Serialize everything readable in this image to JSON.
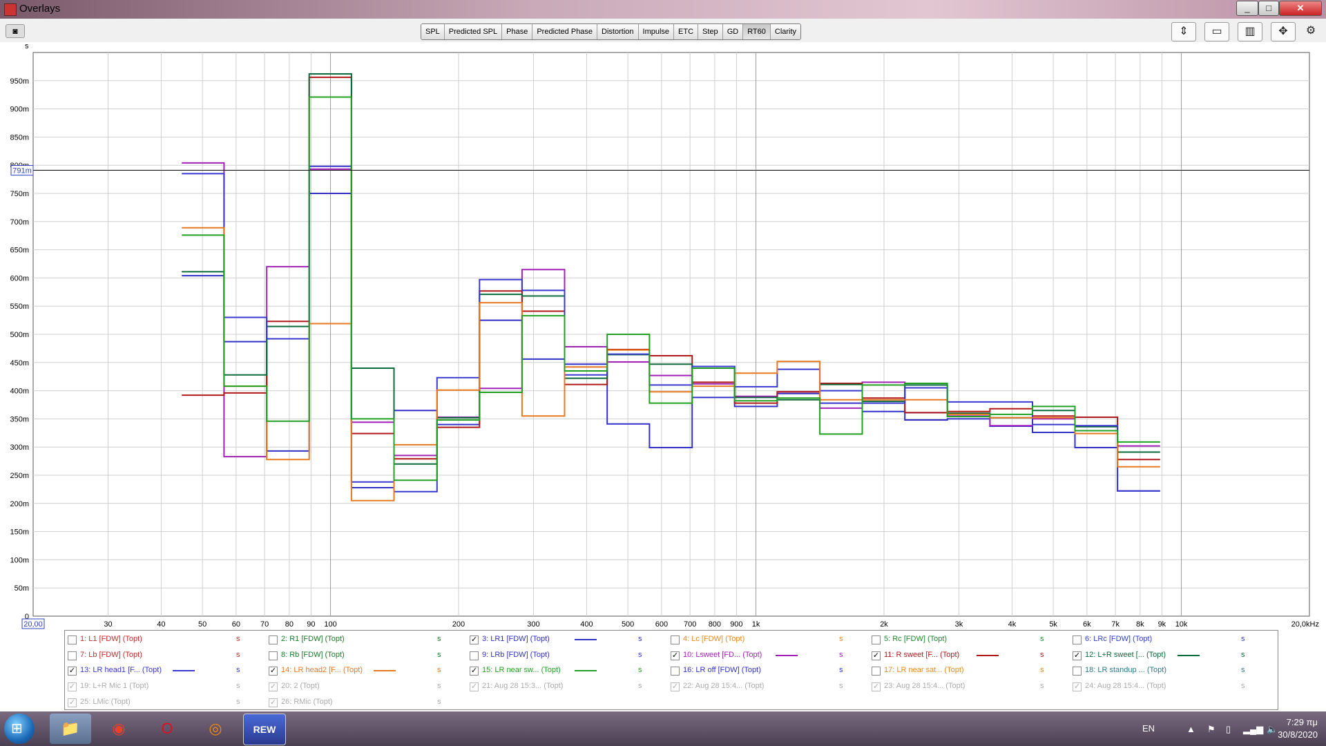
{
  "window": {
    "title": "Overlays",
    "min": "_",
    "max": "□",
    "close": "✕"
  },
  "tabs": [
    {
      "label": "SPL",
      "active": false
    },
    {
      "label": "Predicted SPL",
      "active": false
    },
    {
      "label": "Phase",
      "active": false
    },
    {
      "label": "Predicted Phase",
      "active": false
    },
    {
      "label": "Distortion",
      "active": false
    },
    {
      "label": "Impulse",
      "active": false
    },
    {
      "label": "ETC",
      "active": false
    },
    {
      "label": "Step",
      "active": false
    },
    {
      "label": "GD",
      "active": false
    },
    {
      "label": "RT60",
      "active": true
    },
    {
      "label": "Clarity",
      "active": false
    }
  ],
  "toolbar_icons": [
    "capture-icon",
    "vertical-zoom-icon",
    "limits-icon",
    "controls-icon",
    "fit-icon",
    "gear-icon"
  ],
  "y_unit": "s",
  "cursor_label": "791m",
  "cursor_value": 0.791,
  "x_start_label": "20,00",
  "chart_data": {
    "type": "line",
    "xscale": "log",
    "xlim": [
      20,
      20000
    ],
    "ylim": [
      0,
      1.0
    ],
    "xlabel": "",
    "ylabel": "s",
    "yticks": [
      {
        "v": 0,
        "label": "0"
      },
      {
        "v": 0.05,
        "label": "50m"
      },
      {
        "v": 0.1,
        "label": "100m"
      },
      {
        "v": 0.15,
        "label": "150m"
      },
      {
        "v": 0.2,
        "label": "200m"
      },
      {
        "v": 0.25,
        "label": "250m"
      },
      {
        "v": 0.3,
        "label": "300m"
      },
      {
        "v": 0.35,
        "label": "350m"
      },
      {
        "v": 0.4,
        "label": "400m"
      },
      {
        "v": 0.45,
        "label": "450m"
      },
      {
        "v": 0.5,
        "label": "500m"
      },
      {
        "v": 0.55,
        "label": "550m"
      },
      {
        "v": 0.6,
        "label": "600m"
      },
      {
        "v": 0.65,
        "label": "650m"
      },
      {
        "v": 0.7,
        "label": "700m"
      },
      {
        "v": 0.75,
        "label": "750m"
      },
      {
        "v": 0.8,
        "label": "800m"
      },
      {
        "v": 0.85,
        "label": "850m"
      },
      {
        "v": 0.9,
        "label": "900m"
      },
      {
        "v": 0.95,
        "label": "950m"
      }
    ],
    "xticks": [
      {
        "v": 30,
        "label": "30"
      },
      {
        "v": 40,
        "label": "40"
      },
      {
        "v": 50,
        "label": "50"
      },
      {
        "v": 60,
        "label": "60"
      },
      {
        "v": 70,
        "label": "70"
      },
      {
        "v": 80,
        "label": "80"
      },
      {
        "v": 90,
        "label": "90"
      },
      {
        "v": 100,
        "label": "100"
      },
      {
        "v": 200,
        "label": "200"
      },
      {
        "v": 300,
        "label": "300"
      },
      {
        "v": 400,
        "label": "400"
      },
      {
        "v": 500,
        "label": "500"
      },
      {
        "v": 600,
        "label": "600"
      },
      {
        "v": 700,
        "label": "700"
      },
      {
        "v": 800,
        "label": "800"
      },
      {
        "v": 900,
        "label": "900"
      },
      {
        "v": 1000,
        "label": "1k"
      },
      {
        "v": 2000,
        "label": "2k"
      },
      {
        "v": 3000,
        "label": "3k"
      },
      {
        "v": 4000,
        "label": "4k"
      },
      {
        "v": 5000,
        "label": "5k"
      },
      {
        "v": 6000,
        "label": "6k"
      },
      {
        "v": 7000,
        "label": "7k"
      },
      {
        "v": 8000,
        "label": "8k"
      },
      {
        "v": 9000,
        "label": "9k"
      },
      {
        "v": 10000,
        "label": "10k"
      },
      {
        "v": 20000,
        "label": "20,0kHz"
      }
    ],
    "bands": [
      44.7,
      56.2,
      70.8,
      89.1,
      112,
      141,
      178,
      224,
      282,
      355,
      447,
      562,
      708,
      891,
      1122,
      1413,
      1778,
      2239,
      2818,
      3548,
      4467,
      5623,
      7079,
      8913,
      11220
    ],
    "series": [
      {
        "name": "3: LR1 [FDW] (Topt)",
        "color": "#3030c8",
        "values": [
          0.604,
          0.487,
          0.293,
          0.75,
          0.228,
          0.365,
          0.34,
          0.525,
          0.456,
          0.447,
          0.341,
          0.299,
          0.388,
          0.372,
          0.395,
          0.378,
          0.363,
          0.348,
          0.35,
          0.337,
          0.326,
          0.299,
          0.222
        ]
      },
      {
        "name": "10: Lsweet [FDW] (Topt)",
        "color": "#a020b8",
        "values": [
          0.804,
          0.283,
          0.62,
          0.793,
          0.344,
          0.285,
          0.353,
          0.404,
          0.615,
          0.478,
          0.451,
          0.427,
          0.412,
          0.39,
          0.398,
          0.369,
          0.415,
          0.361,
          0.355,
          0.338,
          0.35,
          0.353,
          0.302
        ]
      },
      {
        "name": "11: R sweet [F... (Topt)",
        "color": "#b01818",
        "values": [
          0.392,
          0.396,
          0.523,
          0.956,
          0.324,
          0.279,
          0.335,
          0.577,
          0.541,
          0.411,
          0.473,
          0.462,
          0.415,
          0.378,
          0.398,
          0.413,
          0.387,
          0.361,
          0.363,
          0.368,
          0.355,
          0.353,
          0.278
        ]
      },
      {
        "name": "12: L+R sweet [... (Topt)",
        "color": "#0b6a3a",
        "values": [
          0.611,
          0.428,
          0.514,
          0.962,
          0.44,
          0.27,
          0.352,
          0.571,
          0.568,
          0.422,
          0.464,
          0.447,
          0.443,
          0.388,
          0.384,
          0.411,
          0.381,
          0.41,
          0.36,
          0.352,
          0.365,
          0.336,
          0.291
        ]
      },
      {
        "name": "13: LR head1 [F... (Topt)",
        "color": "#3838d0",
        "values": [
          0.785,
          0.53,
          0.492,
          0.798,
          0.238,
          0.221,
          0.423,
          0.597,
          0.578,
          0.428,
          0.465,
          0.41,
          0.443,
          0.407,
          0.438,
          0.4,
          0.378,
          0.405,
          0.38,
          0.38,
          0.34,
          0.338,
          0.222
        ]
      },
      {
        "name": "14: LR head2 [F... (Topt)",
        "color": "#e87820",
        "values": [
          0.689,
          0.408,
          0.278,
          0.519,
          0.205,
          0.304,
          0.401,
          0.556,
          0.355,
          0.442,
          0.472,
          0.398,
          0.408,
          0.431,
          0.452,
          0.384,
          0.384,
          0.384,
          0.358,
          0.352,
          0.352,
          0.324,
          0.265
        ]
      },
      {
        "name": "15: LR near sw... (Topt)",
        "color": "#20a020",
        "values": [
          0.676,
          0.408,
          0.346,
          0.921,
          0.35,
          0.241,
          0.348,
          0.397,
          0.533,
          0.435,
          0.5,
          0.378,
          0.44,
          0.382,
          0.387,
          0.323,
          0.41,
          0.413,
          0.354,
          0.358,
          0.372,
          0.329,
          0.309
        ]
      }
    ]
  },
  "legend": [
    {
      "label": "1: L1 [FDW] (Topt)",
      "color": "#c82828",
      "checked": false,
      "dim": false,
      "unit": "s"
    },
    {
      "label": "2: R1 [FDW] (Topt)",
      "color": "#1a7a2a",
      "checked": false,
      "dim": false,
      "unit": "s"
    },
    {
      "label": "3: LR1 [FDW] (Topt)",
      "color": "#3030c8",
      "checked": true,
      "dim": false,
      "unit": "s"
    },
    {
      "label": "4: Lc [FDW] (Topt)",
      "color": "#e88a20",
      "checked": false,
      "dim": false,
      "unit": "s"
    },
    {
      "label": "5: Rc [FDW] (Topt)",
      "color": "#1a8a2a",
      "checked": false,
      "dim": false,
      "unit": "s"
    },
    {
      "label": "6: LRc [FDW] (Topt)",
      "color": "#3040c8",
      "checked": false,
      "dim": false,
      "unit": "s"
    },
    {
      "label": "7: Lb [FDW] (Topt)",
      "color": "#c82828",
      "checked": false,
      "dim": false,
      "unit": "s"
    },
    {
      "label": "8: Rb [FDW] (Topt)",
      "color": "#1a7a2a",
      "checked": false,
      "dim": false,
      "unit": "s"
    },
    {
      "label": "9: LRb [FDW] (Topt)",
      "color": "#3030c8",
      "checked": false,
      "dim": false,
      "unit": "s"
    },
    {
      "label": "10: Lsweet [FD... (Topt)",
      "color": "#a020b8",
      "checked": true,
      "dim": false,
      "unit": "s"
    },
    {
      "label": "11: R sweet [F... (Topt)",
      "color": "#b01818",
      "checked": true,
      "dim": false,
      "unit": "s"
    },
    {
      "label": "12: L+R sweet [... (Topt)",
      "color": "#0b6a3a",
      "checked": true,
      "dim": false,
      "unit": "s"
    },
    {
      "label": "13: LR head1 [F... (Topt)",
      "color": "#3838d0",
      "checked": true,
      "dim": false,
      "unit": "s"
    },
    {
      "label": "14: LR head2 [F... (Topt)",
      "color": "#e87820",
      "checked": true,
      "dim": false,
      "unit": "s"
    },
    {
      "label": "15: LR near sw... (Topt)",
      "color": "#20a020",
      "checked": true,
      "dim": false,
      "unit": "s"
    },
    {
      "label": "16: LR off [FDW] (Topt)",
      "color": "#3030c8",
      "checked": false,
      "dim": false,
      "unit": "s"
    },
    {
      "label": "17: LR near sat... (Topt)",
      "color": "#e88a20",
      "checked": false,
      "dim": false,
      "unit": "s"
    },
    {
      "label": "18: LR standup ... (Topt)",
      "color": "#2a7a8a",
      "checked": false,
      "dim": false,
      "unit": "s"
    },
    {
      "label": "19: L+R Mic 1 (Topt)",
      "color": "#aaaaaa",
      "checked": true,
      "dim": true,
      "unit": "s"
    },
    {
      "label": "20: 2 (Topt)",
      "color": "#aaaaaa",
      "checked": true,
      "dim": true,
      "unit": "s"
    },
    {
      "label": "21: Aug 28 15:3... (Topt)",
      "color": "#aaaaaa",
      "checked": true,
      "dim": true,
      "unit": "s"
    },
    {
      "label": "22: Aug 28 15:4... (Topt)",
      "color": "#aaaaaa",
      "checked": true,
      "dim": true,
      "unit": "s"
    },
    {
      "label": "23: Aug 28 15:4... (Topt)",
      "color": "#aaaaaa",
      "checked": true,
      "dim": true,
      "unit": "s"
    },
    {
      "label": "24: Aug 28 15:4... (Topt)",
      "color": "#aaaaaa",
      "checked": true,
      "dim": true,
      "unit": "s"
    },
    {
      "label": "25: LMic (Topt)",
      "color": "#aaaaaa",
      "checked": true,
      "dim": true,
      "unit": "s"
    },
    {
      "label": "26: RMic (Topt)",
      "color": "#aaaaaa",
      "checked": true,
      "dim": true,
      "unit": "s"
    }
  ],
  "taskbar": {
    "start": "⊞",
    "apps": [
      {
        "name": "explorer",
        "glyph": "📁"
      },
      {
        "name": "chrome",
        "glyph": "◉"
      },
      {
        "name": "opera",
        "glyph": "O"
      },
      {
        "name": "avast",
        "glyph": "◎"
      },
      {
        "name": "rew",
        "glyph": "REW"
      }
    ],
    "lang": "EN",
    "time": "7:29 πμ",
    "date": "30/8/2020"
  }
}
